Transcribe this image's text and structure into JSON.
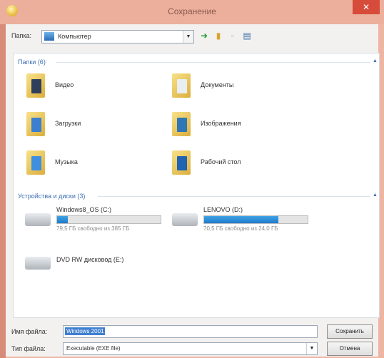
{
  "window": {
    "title": "Сохранение",
    "close_glyph": "✕",
    "accent": "#ecaf9c",
    "close_bg": "#d74b3a"
  },
  "toolbar": {
    "folder_label": "Папка:",
    "location": "Компьютер",
    "back_icon": "green-arrow-icon",
    "up_icon": "folder-up-icon",
    "new_folder_icon": "new-folder-icon",
    "view_icon": "view-menu-icon"
  },
  "groups": {
    "folders_title": "Папки (6)",
    "devices_title": "Устройства и диски (3)"
  },
  "folders": [
    {
      "name": "Видео",
      "icon": "videos-folder-icon"
    },
    {
      "name": "Документы",
      "icon": "documents-folder-icon"
    },
    {
      "name": "Загрузки",
      "icon": "downloads-folder-icon"
    },
    {
      "name": "Изображения",
      "icon": "pictures-folder-icon"
    },
    {
      "name": "Музыка",
      "icon": "music-folder-icon"
    },
    {
      "name": "Рабочий стол",
      "icon": "desktop-folder-icon"
    }
  ],
  "drives": [
    {
      "name": "Windows8_OS (C:)",
      "free": "79,5 ГБ свободно из 385 ГБ",
      "used_fraction": 0.1,
      "icon": "system-drive-icon"
    },
    {
      "name": "LENOVO (D:)",
      "free": "70,5 ГБ свободно из 24,0 ГБ",
      "used_fraction": 0.72,
      "icon": "drive-icon"
    },
    {
      "name": "DVD RW дисковод (E:)",
      "icon": "dvd-drive-icon"
    }
  ],
  "bottom": {
    "filename_label": "Имя файла:",
    "filename_value": "Windows 2001",
    "filetype_label": "Тип файла:",
    "filetype_value": "Executable (EXE file)",
    "save_button": "Сохранить",
    "cancel_button": "Отмена"
  }
}
